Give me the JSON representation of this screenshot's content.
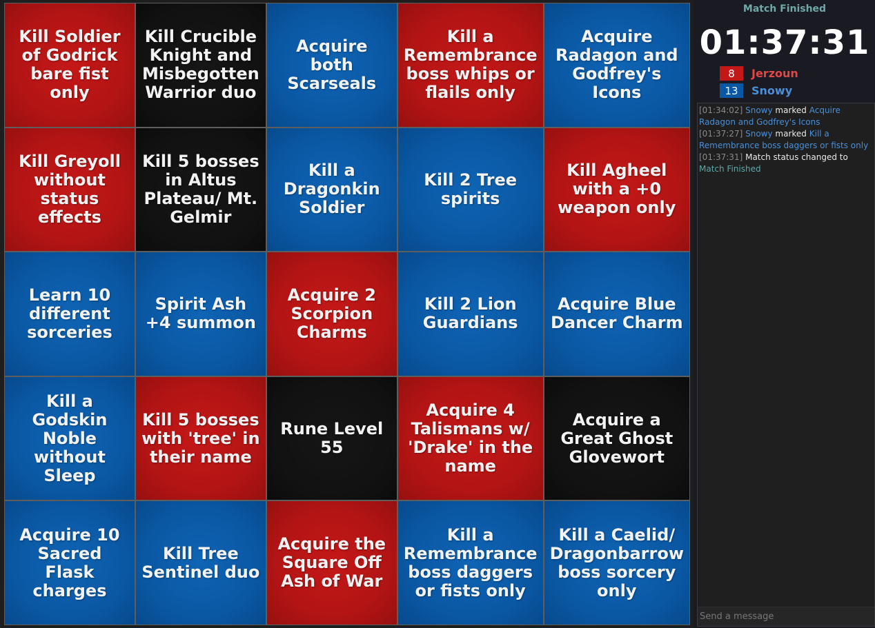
{
  "board": {
    "cells": [
      {
        "text": "Kill Soldier of Godrick bare fist only",
        "color": "red"
      },
      {
        "text": "Kill Crucible Knight and Misbegotten Warrior duo",
        "color": "black"
      },
      {
        "text": "Acquire both Scarseals",
        "color": "blue"
      },
      {
        "text": "Kill a Remembrance boss whips or flails only",
        "color": "red"
      },
      {
        "text": "Acquire Radagon and Godfrey's Icons",
        "color": "blue"
      },
      {
        "text": "Kill Greyoll without status effects",
        "color": "red"
      },
      {
        "text": "Kill 5 bosses in Altus Plateau/ Mt. Gelmir",
        "color": "black"
      },
      {
        "text": "Kill a Dragonkin Soldier",
        "color": "blue"
      },
      {
        "text": "Kill 2 Tree spirits",
        "color": "blue"
      },
      {
        "text": "Kill Agheel with a +0 weapon only",
        "color": "red"
      },
      {
        "text": "Learn 10 different sorceries",
        "color": "blue"
      },
      {
        "text": "Spirit Ash +4 summon",
        "color": "blue"
      },
      {
        "text": "Acquire 2 Scorpion Charms",
        "color": "red"
      },
      {
        "text": "Kill 2 Lion Guardians",
        "color": "blue"
      },
      {
        "text": "Acquire Blue Dancer Charm",
        "color": "blue"
      },
      {
        "text": "Kill a Godskin Noble without Sleep",
        "color": "blue"
      },
      {
        "text": "Kill 5 bosses with 'tree' in their name",
        "color": "red"
      },
      {
        "text": "Rune Level 55",
        "color": "black"
      },
      {
        "text": "Acquire 4 Talismans w/ 'Drake' in the name",
        "color": "red"
      },
      {
        "text": "Acquire a Great Ghost Glovewort",
        "color": "black"
      },
      {
        "text": "Acquire 10 Sacred Flask charges",
        "color": "blue"
      },
      {
        "text": "Kill Tree Sentinel duo",
        "color": "blue"
      },
      {
        "text": "Acquire the Square Off Ash of War",
        "color": "red"
      },
      {
        "text": "Kill a Remembrance boss daggers or fists only",
        "color": "blue"
      },
      {
        "text": "Kill a Caelid/ Dragonbarrow boss sorcery only",
        "color": "blue"
      }
    ]
  },
  "sidebar": {
    "status": "Match Finished",
    "timer": "01:37:31",
    "players": [
      {
        "score": "8",
        "name": "Jerzoun",
        "badge_color": "#c41818",
        "name_color": "#e04848"
      },
      {
        "score": "13",
        "name": "Snowy",
        "badge_color": "#0a58a4",
        "name_color": "#4a8fd8"
      }
    ]
  },
  "chat": {
    "messages": [
      {
        "time": "[01:34:02]",
        "user": "Snowy",
        "action": "marked",
        "object": "Acquire Radagon and Godfrey's Icons"
      },
      {
        "time": "[01:37:27]",
        "user": "Snowy",
        "action": "marked",
        "object": "Kill a Remembrance boss daggers or fists only"
      },
      {
        "time": "[01:37:31]",
        "text": "Match status changed to",
        "status": "Match Finished"
      }
    ],
    "placeholder": "Send a message"
  },
  "colors": {
    "red": "#b31414",
    "blue": "#0a58a4",
    "black": "#111111",
    "status_teal": "#6fa8a8"
  }
}
